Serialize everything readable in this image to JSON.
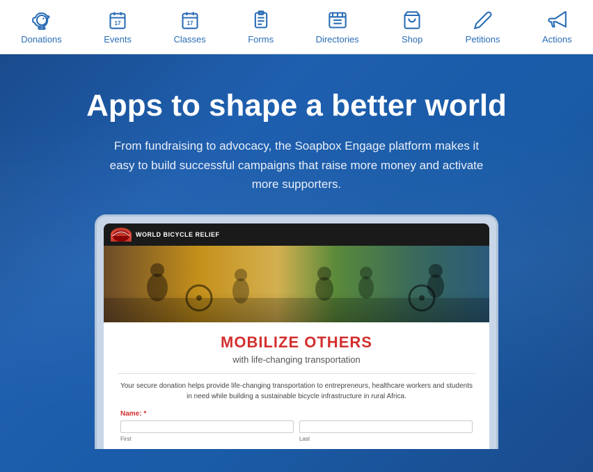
{
  "navbar": {
    "items": [
      {
        "id": "donations",
        "label": "Donations",
        "icon": "piggy-bank"
      },
      {
        "id": "events",
        "label": "Events",
        "icon": "calendar-17"
      },
      {
        "id": "classes",
        "label": "Classes",
        "icon": "calendar-17-alt"
      },
      {
        "id": "forms",
        "label": "Forms",
        "icon": "clipboard"
      },
      {
        "id": "directories",
        "label": "Directories",
        "icon": "list"
      },
      {
        "id": "shop",
        "label": "Shop",
        "icon": "bag"
      },
      {
        "id": "petitions",
        "label": "Petitions",
        "icon": "pen"
      },
      {
        "id": "actions",
        "label": "Actions",
        "icon": "megaphone"
      }
    ]
  },
  "hero": {
    "title": "Apps to shape a better world",
    "subtitle": "From fundraising to advocacy, the Soapbox Engage platform makes it easy to build successful campaigns that raise more money and activate more supporters."
  },
  "mockup": {
    "org_name": "WORLD BICYCLE RELIEF",
    "screen_title": "MOBILIZE OTHERS",
    "screen_subtitle": "with life-changing transportation",
    "screen_text": "Your secure donation helps provide life-changing transportation to entrepreneurs, healthcare workers and students in need while building a sustainable bicycle infrastructure in rural Africa.",
    "form_label": "Name:",
    "form_required": "*",
    "form_first": "First",
    "form_last": "Last"
  }
}
